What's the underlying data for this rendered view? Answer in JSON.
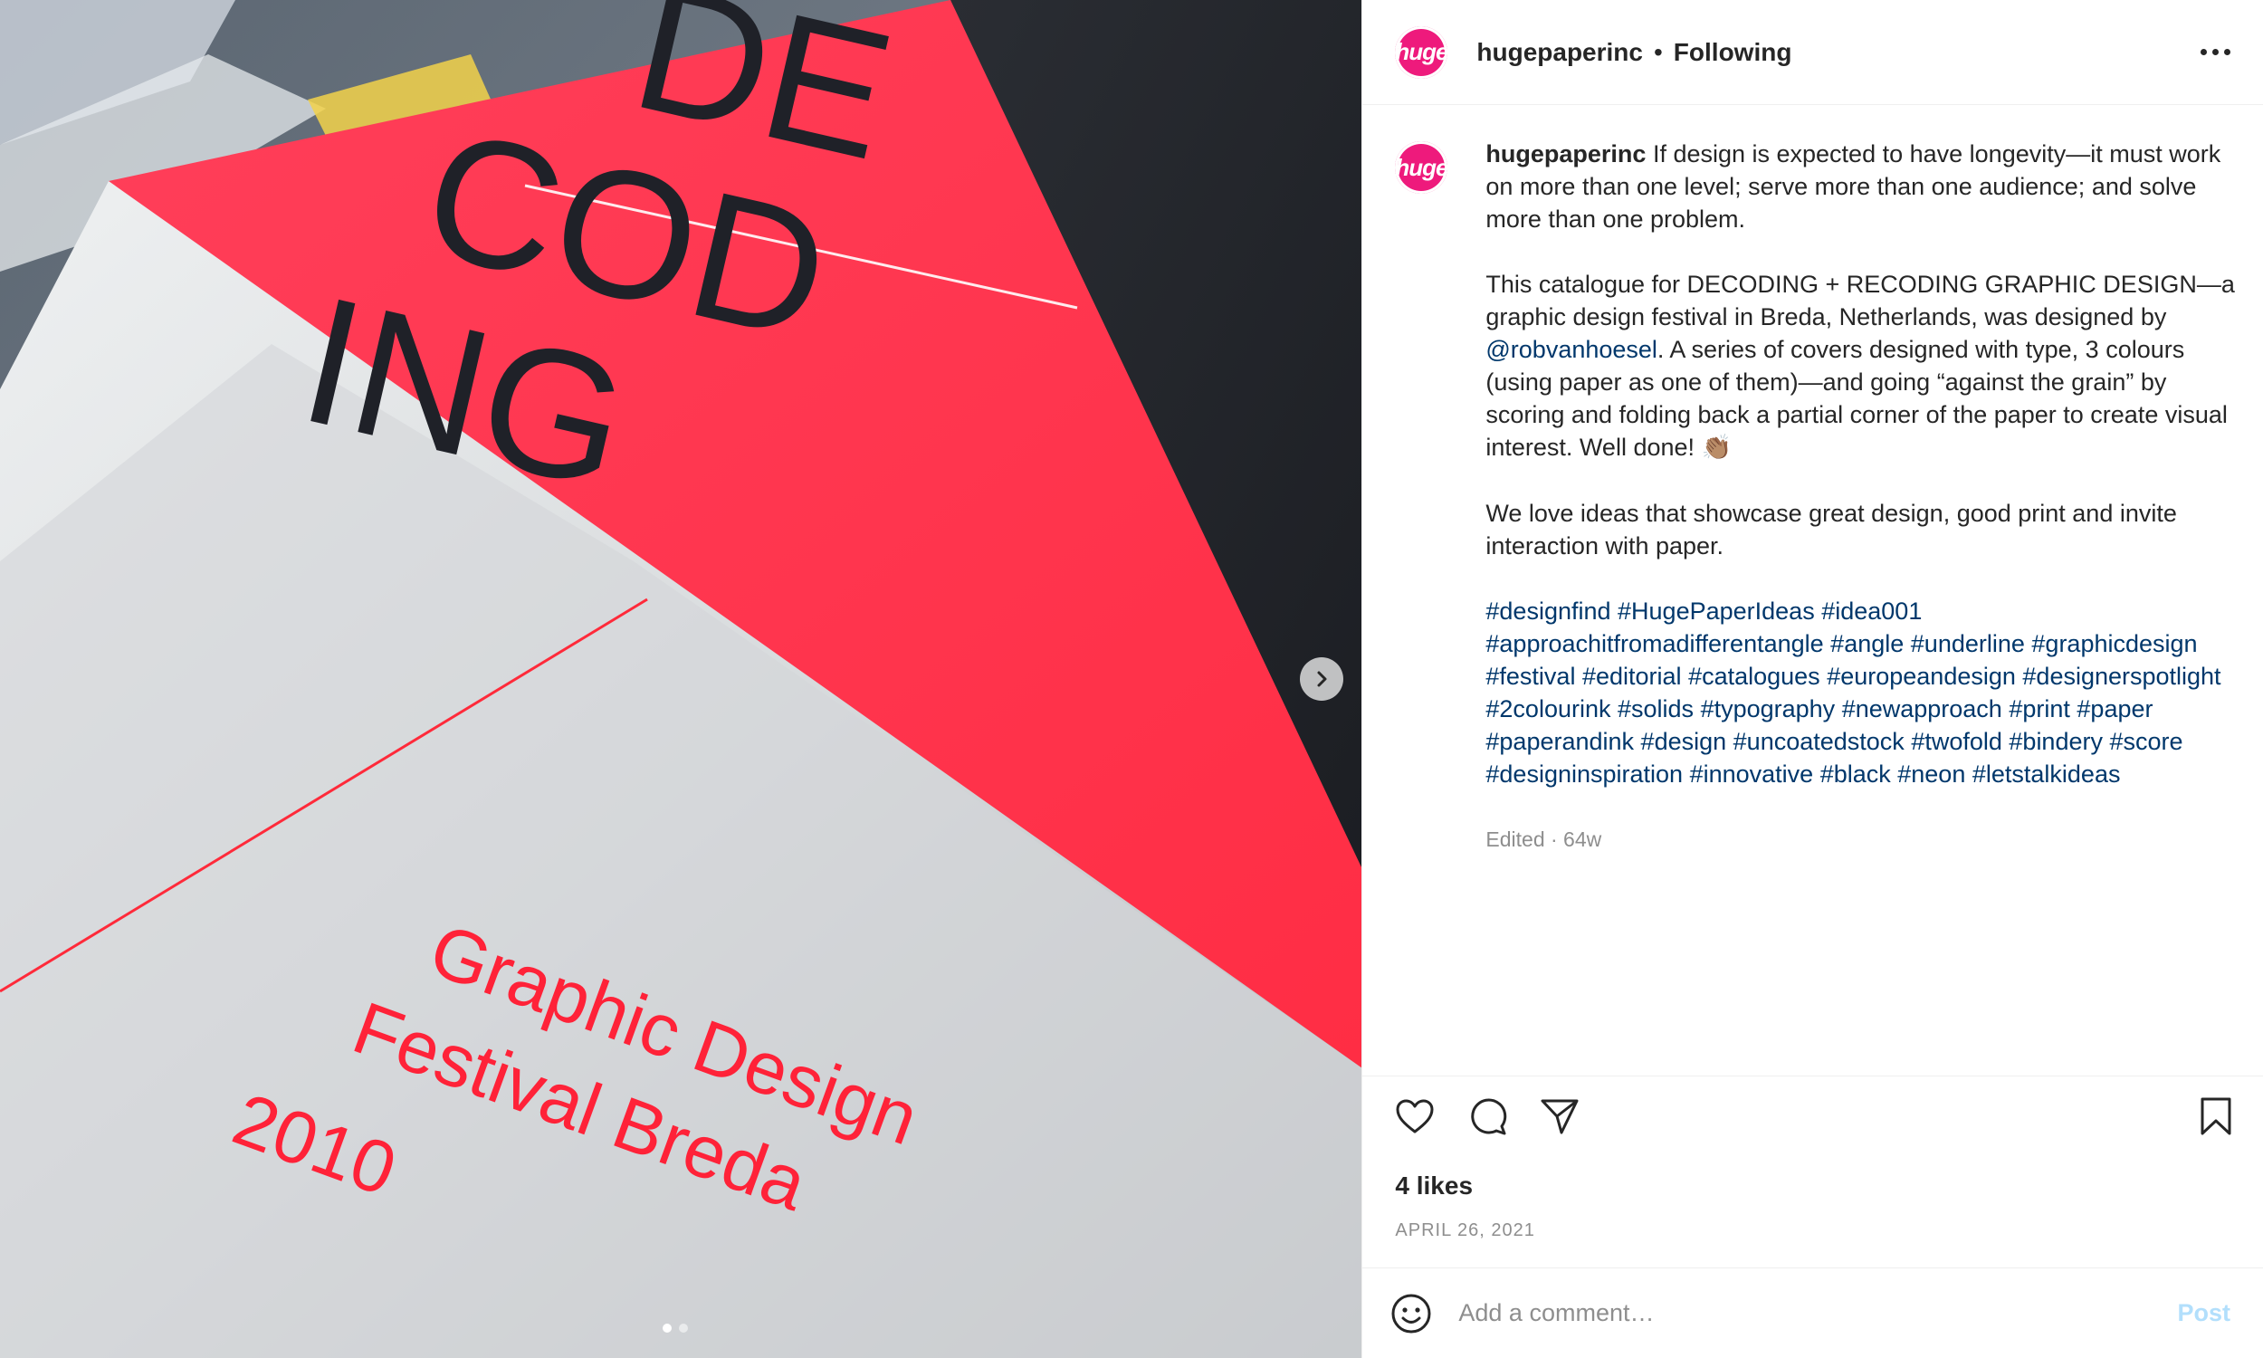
{
  "colors": {
    "brand": "#ee1a7c",
    "neon": "#ff3b4e",
    "link": "#00376b",
    "post_disabled": "#b2dffc"
  },
  "media": {
    "cover_text_lines": [
      "DE",
      "COD",
      "ING"
    ],
    "festival_lines": [
      "Graphic Design",
      "Festival Breda",
      "2010"
    ],
    "carousel": {
      "current": 1,
      "total": 2
    },
    "next_icon": "chevron-right-icon"
  },
  "header": {
    "avatar_text": "huge",
    "username": "hugepaperinc",
    "separator": "•",
    "follow_label": "Following",
    "more_icon": "more-options-icon"
  },
  "caption": {
    "avatar_text": "huge",
    "username": "hugepaperinc",
    "para1": "If design is expected to have longevity—it must work on more than one level; serve more than one audience; and solve more than one problem.",
    "para2_before": "This catalogue for DECODING + RECODING GRAPHIC DESIGN—a graphic design festival in Breda, Netherlands, was designed by ",
    "mention": "@robvanhoesel",
    "para2_after": ". A series of covers designed with type, 3 colours (using paper as one of them)—and going “against the grain” by scoring and folding back a partial corner of the paper to create visual interest. Well done! ",
    "emoji": "👏🏽",
    "para3": "We love ideas that showcase great design, good print and invite interaction with paper.",
    "hashtags": [
      "#designfind",
      "#HugePaperIdeas",
      "#idea001",
      "#approachitfromadifferentangle",
      "#angle",
      "#underline",
      "#graphicdesign",
      "#festival",
      "#editorial",
      "#catalogues",
      "#europeandesign",
      "#designerspotlight",
      "#2colourink",
      "#solids",
      "#typography",
      "#newapproach",
      "#print",
      "#paper",
      "#paperandink",
      "#design",
      "#uncoatedstock",
      "#twofold",
      "#bindery",
      "#score",
      "#designinspiration",
      "#innovative",
      "#black",
      "#neon",
      "#letstalkideas"
    ],
    "meta": "Edited · 64w"
  },
  "actions": {
    "like_icon": "heart-icon",
    "comment_icon": "comment-icon",
    "share_icon": "share-icon",
    "save_icon": "bookmark-icon"
  },
  "likes": "4 likes",
  "date": "APRIL 26, 2021",
  "comment_box": {
    "emoji_icon": "emoji-icon",
    "placeholder": "Add a comment…",
    "post_label": "Post"
  }
}
